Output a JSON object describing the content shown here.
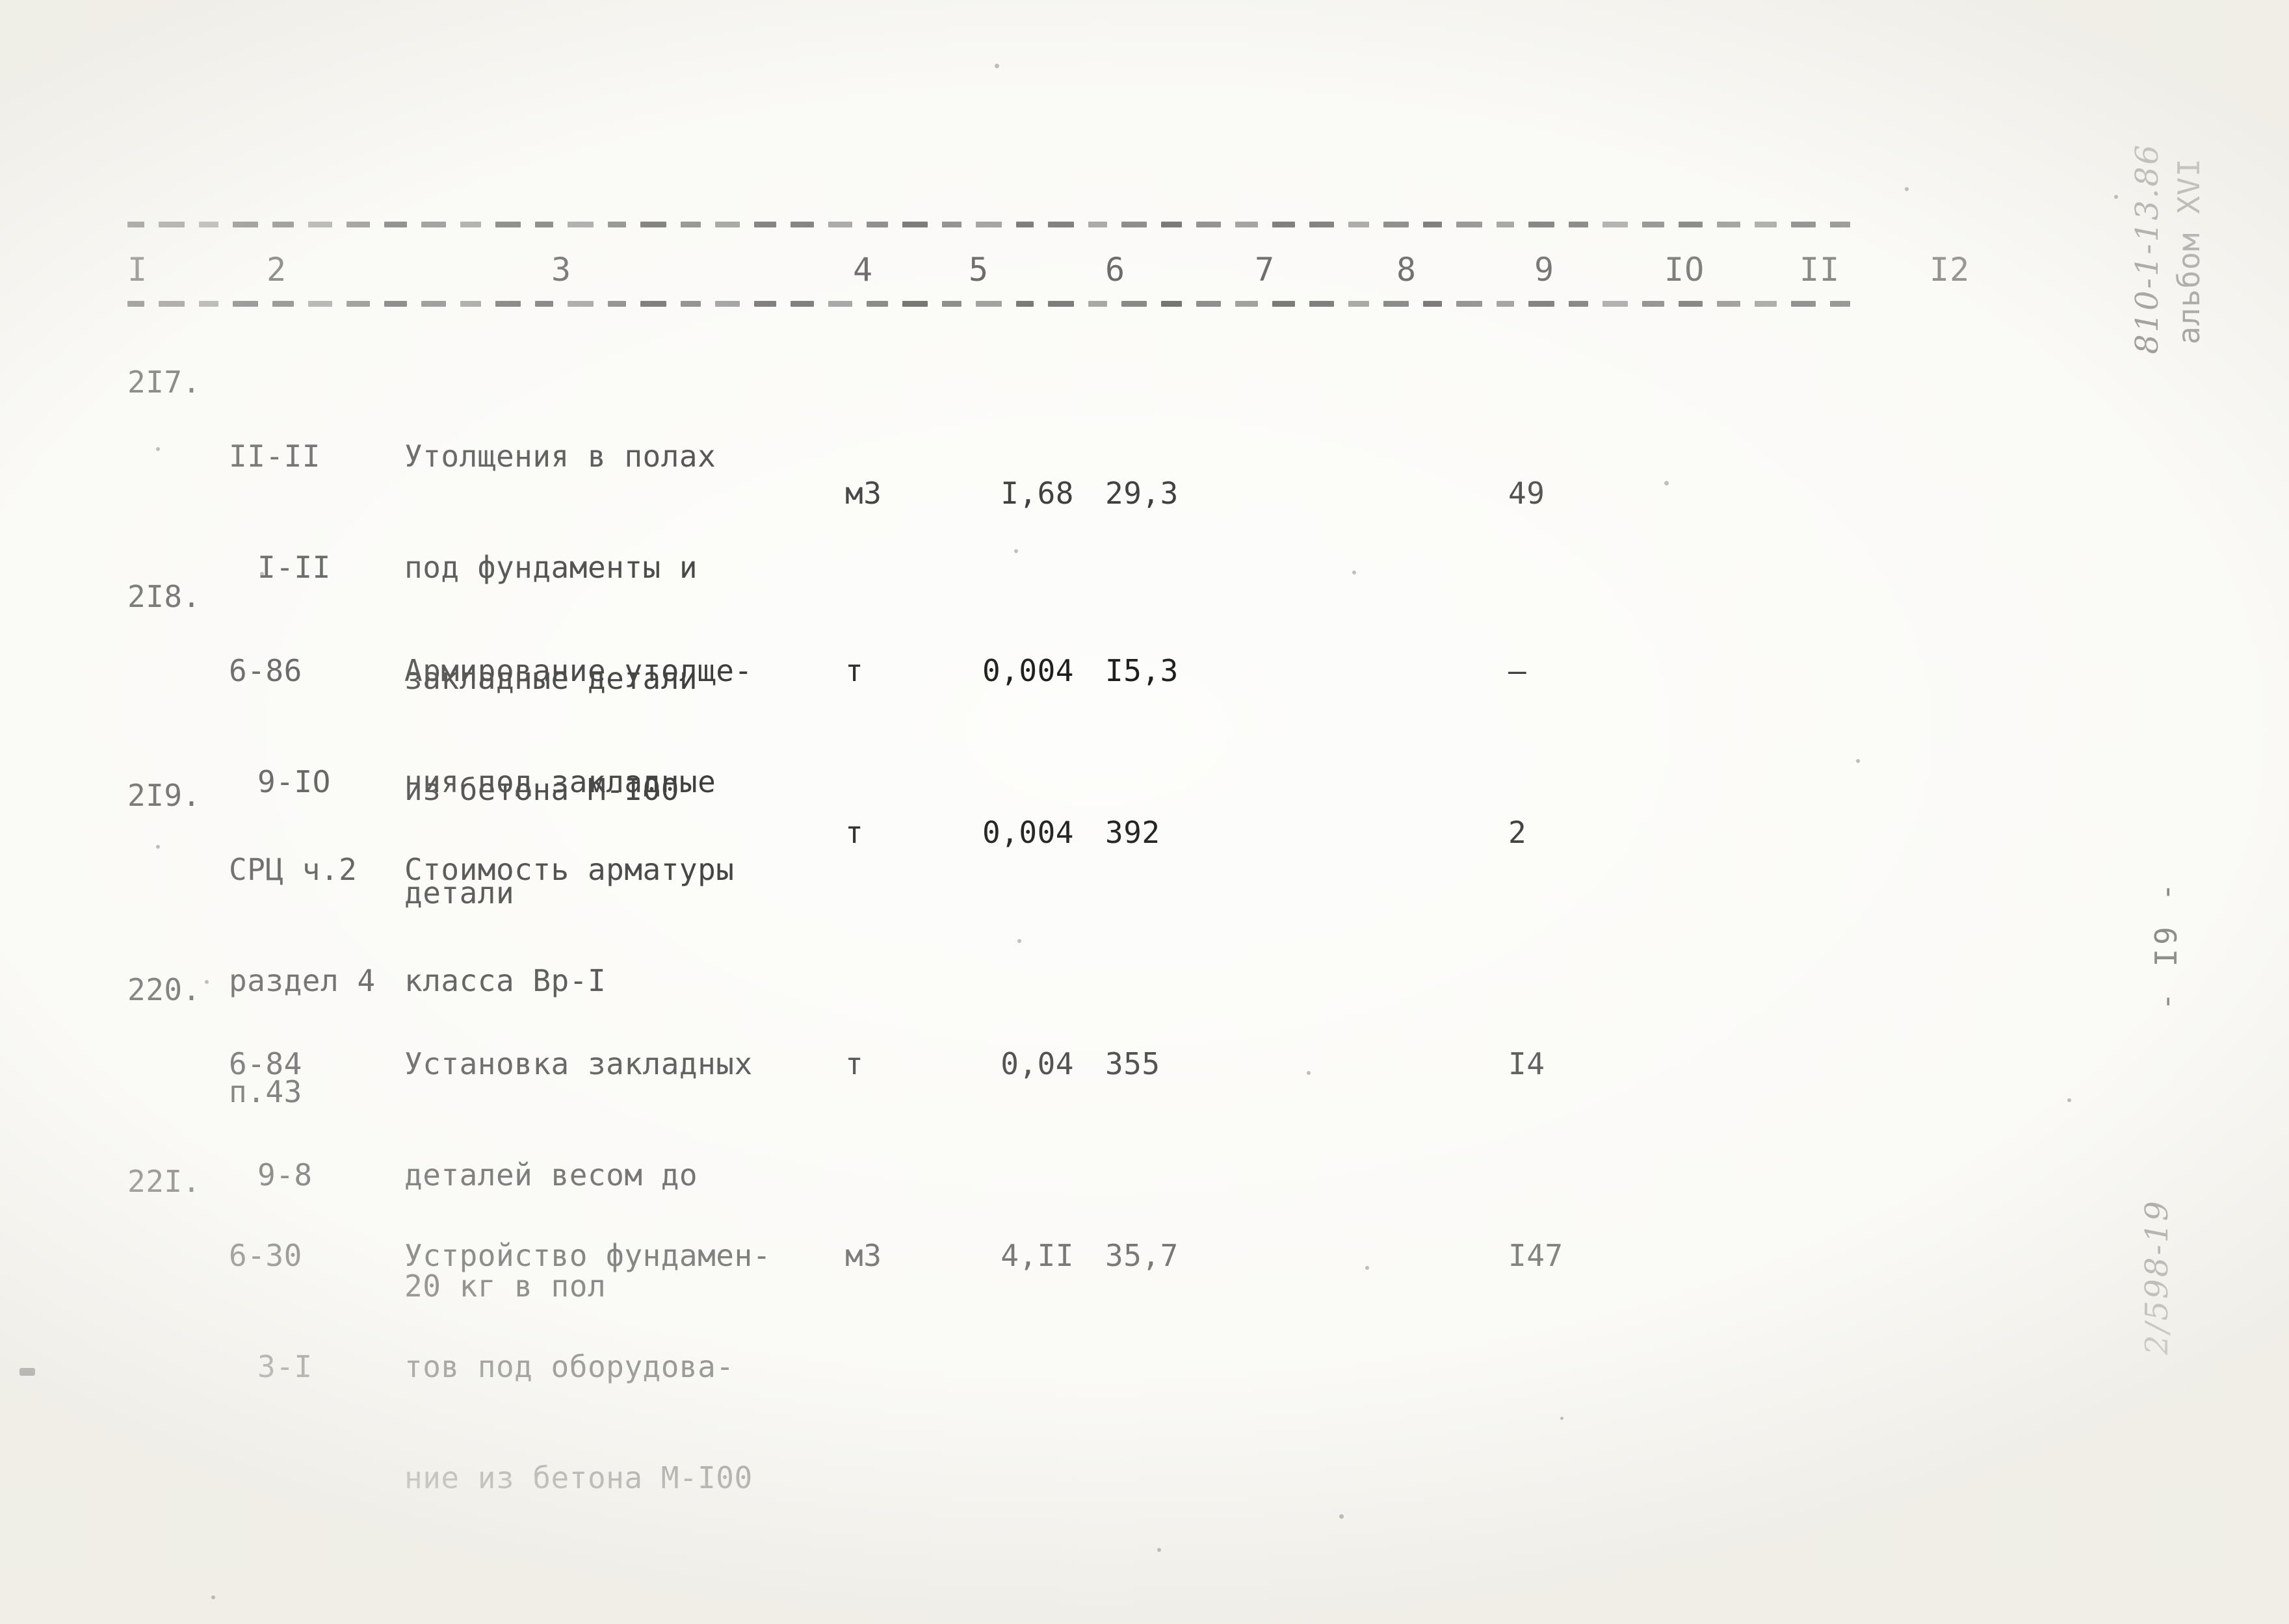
{
  "document": {
    "type": "typewritten-estimate-table",
    "page_number": "- I9 -",
    "margin_album_label": "альбом XVI",
    "margin_album_code": "810-1-13.86",
    "margin_handwritten_code": "2/598-19"
  },
  "table": {
    "column_numbers": [
      "I",
      "2",
      "3",
      "4",
      "5",
      "6",
      "7",
      "8",
      "9",
      "IO",
      "II",
      "I2"
    ],
    "rows": [
      {
        "num": "2I7.",
        "code_lines": [
          "II-II",
          "I-II"
        ],
        "desc_lines": [
          "Утолщения в полах",
          "под фундаменты и",
          "закладные детали",
          "из бетона М-I00"
        ],
        "unit": "м3",
        "qty": "I,68",
        "price": "29,3",
        "col7": "",
        "col8": "",
        "col9": "49"
      },
      {
        "num": "2I8.",
        "code_lines": [
          "6-86",
          "9-IO"
        ],
        "desc_lines": [
          "Армирование утолще-",
          "ния под закладные",
          "детали"
        ],
        "unit": "т",
        "qty": "0,004",
        "price": "I5,3",
        "col7": "",
        "col8": "",
        "col9": "—"
      },
      {
        "num": "2I9.",
        "code_lines": [
          "СРЦ ч.2",
          "раздел 4",
          "п.43"
        ],
        "desc_lines": [
          "Стоимость арматуры",
          "класса Вр-I"
        ],
        "unit": "т",
        "qty": "0,004",
        "price": "392",
        "col7": "",
        "col8": "",
        "col9": "2"
      },
      {
        "num": "220.",
        "code_lines": [
          "6-84",
          "9-8"
        ],
        "desc_lines": [
          "Установка закладных",
          "деталей весом до",
          "20 кг в пол"
        ],
        "unit": "т",
        "qty": "0,04",
        "price": "355",
        "col7": "",
        "col8": "",
        "col9": "I4"
      },
      {
        "num": "22I.",
        "code_lines": [
          "6-30",
          "3-I"
        ],
        "desc_lines": [
          "Устройство фундамен-",
          "тов под оборудова-",
          "ние из бетона М-I00"
        ],
        "unit": "м3",
        "qty": "4,II",
        "price": "35,7",
        "col7": "",
        "col8": "",
        "col9": "I47"
      }
    ]
  },
  "colors": {
    "ink": "#121212",
    "paper": "#fdfdfb"
  }
}
